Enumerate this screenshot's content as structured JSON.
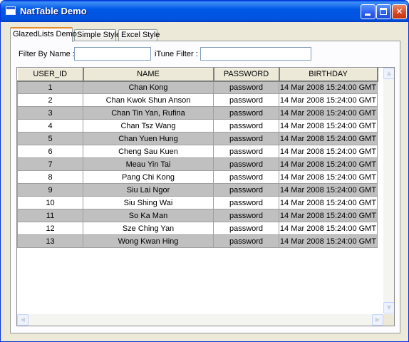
{
  "window": {
    "title": "NatTable Demo",
    "buttons": {
      "minimize": "minimize-icon",
      "maximize": "maximize-icon",
      "close": "close-icon"
    }
  },
  "tabs": [
    {
      "label": "GlazedLists Demo",
      "active": true
    },
    {
      "label": "Simple Style",
      "active": false
    },
    {
      "label": "Excel Style",
      "active": false
    }
  ],
  "filters": {
    "name_label": "Filter By Name :",
    "name_value": "",
    "itune_label": "iTune Filter :",
    "itune_value": ""
  },
  "grid": {
    "columns": [
      "USER_ID",
      "NAME",
      "PASSWORD",
      "BIRTHDAY"
    ],
    "rows": [
      [
        "1",
        "Chan Kong",
        "password",
        "14 Mar 2008 15:24:00 GMT"
      ],
      [
        "2",
        "Chan Kwok Shun Anson",
        "password",
        "14 Mar 2008 15:24:00 GMT"
      ],
      [
        "3",
        "Chan Tin Yan, Rufina",
        "password",
        "14 Mar 2008 15:24:00 GMT"
      ],
      [
        "4",
        "Chan Tsz Wang",
        "password",
        "14 Mar 2008 15:24:00 GMT"
      ],
      [
        "5",
        "Chan Yuen Hung",
        "password",
        "14 Mar 2008 15:24:00 GMT"
      ],
      [
        "6",
        "Cheng Sau Kuen",
        "password",
        "14 Mar 2008 15:24:00 GMT"
      ],
      [
        "7",
        "Meau Yin Tai",
        "password",
        "14 Mar 2008 15:24:00 GMT"
      ],
      [
        "8",
        "Pang Chi Kong",
        "password",
        "14 Mar 2008 15:24:00 GMT"
      ],
      [
        "9",
        "Siu Lai Ngor",
        "password",
        "14 Mar 2008 15:24:00 GMT"
      ],
      [
        "10",
        "Siu Shing Wai",
        "password",
        "14 Mar 2008 15:24:00 GMT"
      ],
      [
        "11",
        "So Ka Man",
        "password",
        "14 Mar 2008 15:24:00 GMT"
      ],
      [
        "12",
        "Sze Ching Yan",
        "password",
        "14 Mar 2008 15:24:00 GMT"
      ],
      [
        "13",
        "Wong Kwan Hing",
        "password",
        "14 Mar 2008 15:24:00 GMT"
      ]
    ]
  },
  "colors": {
    "title_bar": "#0054e3",
    "row_shaded": "#c0c0c0",
    "row_plain": "#ffffff",
    "header_bg": "#ece9d8"
  }
}
